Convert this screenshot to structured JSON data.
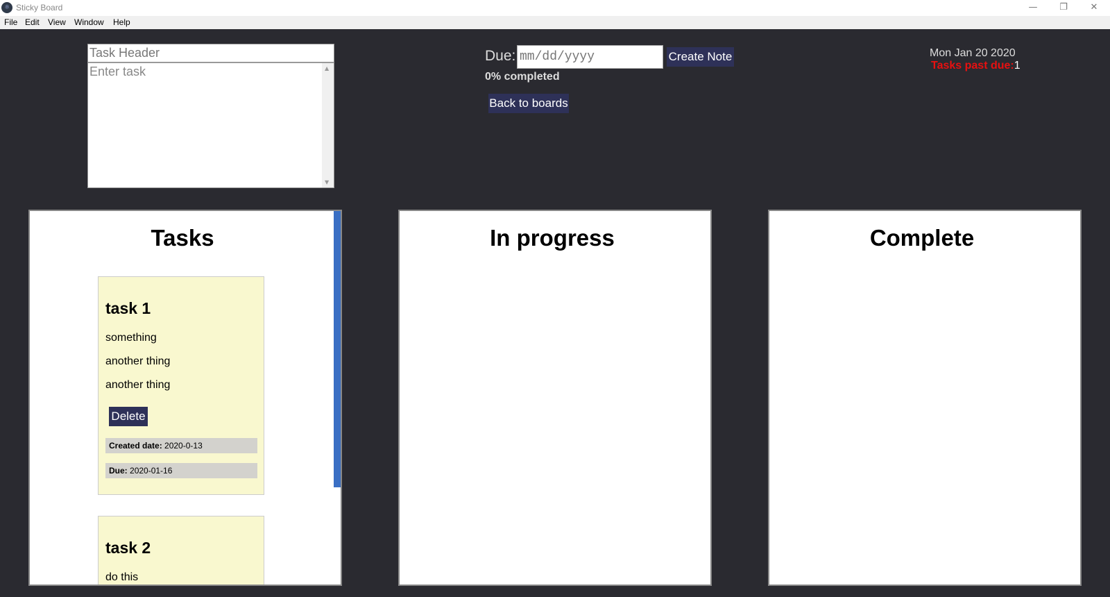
{
  "window": {
    "title": "Sticky Board",
    "icon": "atom-icon",
    "controls": [
      "—",
      "❐",
      "✕"
    ]
  },
  "menu": [
    "File",
    "Edit",
    "View",
    "Window",
    "Help"
  ],
  "form": {
    "header_placeholder": "Task Header",
    "task_placeholder": "Enter task",
    "due_label": "Due:",
    "due_placeholder": "mm/dd/yyyy",
    "create_button": "Create Note",
    "progress_text": "0% completed",
    "back_button": "Back to boards"
  },
  "status": {
    "date": "Mon Jan 20 2020",
    "past_due_label": "Tasks past due:",
    "past_due_count": "1"
  },
  "columns": [
    {
      "title": "Tasks"
    },
    {
      "title": "In progress"
    },
    {
      "title": "Complete"
    }
  ],
  "notes": [
    {
      "title": "task 1",
      "lines": [
        "something",
        "another thing",
        "another thing"
      ],
      "delete_label": "Delete",
      "created_label": "Created date:",
      "created_value": "2020-0-13",
      "due_label": "Due:",
      "due_value": "2020-01-16"
    },
    {
      "title": "task 2",
      "lines": [
        "do this"
      ]
    }
  ],
  "colors": {
    "background": "#2a2a30",
    "button": "#2e3158",
    "note": "#f9f8cf",
    "past_due": "#e81010",
    "scrollbar": "#3a6fc4"
  }
}
